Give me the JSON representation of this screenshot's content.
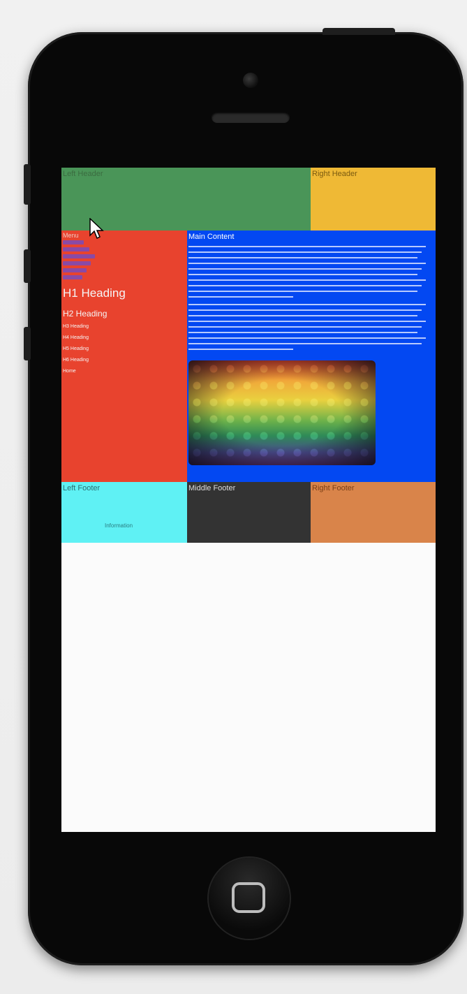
{
  "screen": {
    "left_header": {
      "label": "Left Header",
      "color": "#4a9558"
    },
    "right_header": {
      "label": "Right Header",
      "color": "#efb935"
    },
    "sidebar": {
      "color": "#e8432e",
      "top_label": "Menu",
      "h1": "H1 Heading",
      "h2": "H2 Heading",
      "items": [
        "H3 Heading",
        "H4 Heading",
        "H5 Heading",
        "H6 Heading",
        "Home"
      ]
    },
    "main": {
      "color": "#0348f2",
      "title": "Main Content",
      "image_alt": "rainbow cross pattern image"
    },
    "left_footer": {
      "label": "Left Footer",
      "link": "Information",
      "color": "#5ff1f4"
    },
    "middle_footer": {
      "label": "Middle Footer",
      "color": "#333333"
    },
    "right_footer": {
      "label": "Right Footer",
      "color": "#d9844a"
    }
  },
  "icons": {
    "cursor": "mouse-pointer-icon",
    "home": "home-button-icon"
  }
}
